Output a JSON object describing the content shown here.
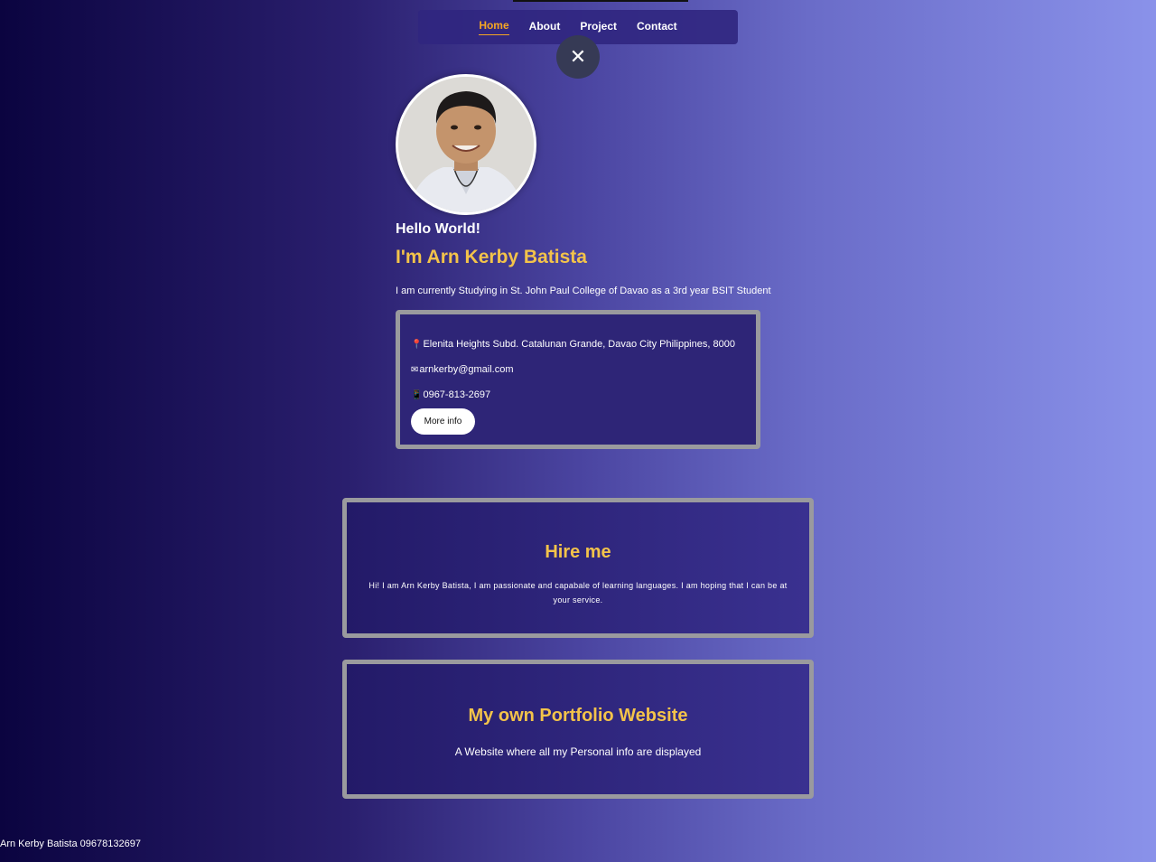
{
  "nav": {
    "items": [
      {
        "label": "Home",
        "active": true
      },
      {
        "label": "About",
        "active": false
      },
      {
        "label": "Project",
        "active": false
      },
      {
        "label": "Contact",
        "active": false
      }
    ],
    "close_symbol": "✕"
  },
  "profile": {
    "greeting": "Hello World!",
    "name": "I'm Arn Kerby Batista",
    "bio": "I am currently Studying in St. John Paul College of Davao as a 3rd year BSIT Student"
  },
  "contact_card": {
    "address_icon": "📍",
    "address": "Elenita Heights Subd. Catalunan Grande, Davao City Philippines, 8000",
    "email_icon": "✉",
    "email": "arnkerby@gmail.com",
    "phone_icon": "📱",
    "phone": "0967-813-2697",
    "more_button": "More info"
  },
  "hire": {
    "title": "Hire me",
    "text": "Hi! I am Arn Kerby Batista, I am passionate and capabale of learning languages. I am hoping that I can be at your service."
  },
  "portfolio": {
    "title": "My own Portfolio Website",
    "text": "A Website where all my Personal info are displayed"
  },
  "footer": {
    "text": "Arn Kerby Batista 09678132697"
  },
  "colors": {
    "accent": "#f3c34a",
    "nav_active": "#f5a623"
  }
}
